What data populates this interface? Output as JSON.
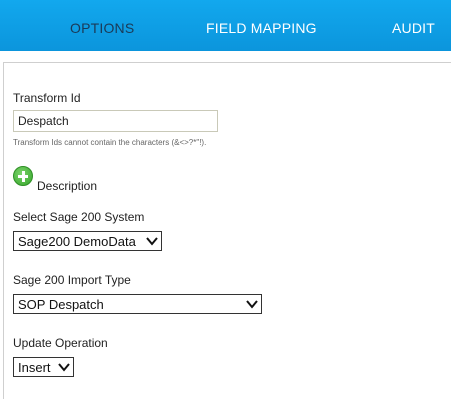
{
  "tabs": {
    "options": "OPTIONS",
    "field_mapping": "FIELD MAPPING",
    "audit": "AUDIT"
  },
  "transform_id": {
    "label": "Transform Id",
    "value": "Despatch",
    "hint": "Transform Ids cannot contain the characters (&<>?*\"!)."
  },
  "description": {
    "label": "Description",
    "icon": "add-circle-icon",
    "icon_color": "#35a52a"
  },
  "sage_system": {
    "label": "Select Sage 200 System",
    "selected": "Sage200 DemoData"
  },
  "import_type": {
    "label": "Sage 200 Import Type",
    "selected": "SOP Despatch"
  },
  "update_operation": {
    "label": "Update Operation",
    "selected": "Insert"
  },
  "colors": {
    "tabbar": "#0b95dc",
    "active_tab_text": "#1b3a57",
    "tab_text": "#ffffff"
  }
}
